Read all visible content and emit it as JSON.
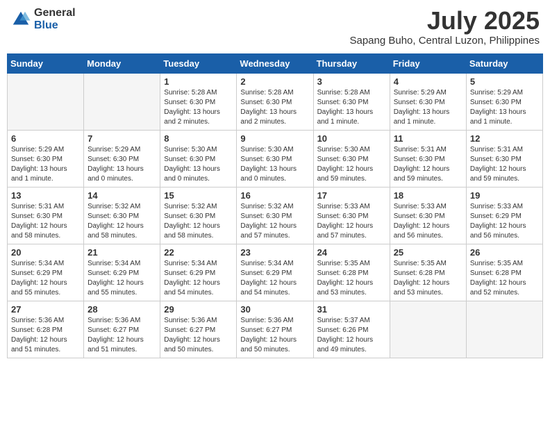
{
  "header": {
    "logo_general": "General",
    "logo_blue": "Blue",
    "month": "July 2025",
    "location": "Sapang Buho, Central Luzon, Philippines"
  },
  "weekdays": [
    "Sunday",
    "Monday",
    "Tuesday",
    "Wednesday",
    "Thursday",
    "Friday",
    "Saturday"
  ],
  "weeks": [
    [
      {
        "day": "",
        "empty": true
      },
      {
        "day": "",
        "empty": true
      },
      {
        "day": "1",
        "sunrise": "5:28 AM",
        "sunset": "6:30 PM",
        "daylight": "13 hours and 2 minutes."
      },
      {
        "day": "2",
        "sunrise": "5:28 AM",
        "sunset": "6:30 PM",
        "daylight": "13 hours and 2 minutes."
      },
      {
        "day": "3",
        "sunrise": "5:28 AM",
        "sunset": "6:30 PM",
        "daylight": "13 hours and 1 minute."
      },
      {
        "day": "4",
        "sunrise": "5:29 AM",
        "sunset": "6:30 PM",
        "daylight": "13 hours and 1 minute."
      },
      {
        "day": "5",
        "sunrise": "5:29 AM",
        "sunset": "6:30 PM",
        "daylight": "13 hours and 1 minute."
      }
    ],
    [
      {
        "day": "6",
        "sunrise": "5:29 AM",
        "sunset": "6:30 PM",
        "daylight": "13 hours and 1 minute."
      },
      {
        "day": "7",
        "sunrise": "5:29 AM",
        "sunset": "6:30 PM",
        "daylight": "13 hours and 0 minutes."
      },
      {
        "day": "8",
        "sunrise": "5:30 AM",
        "sunset": "6:30 PM",
        "daylight": "13 hours and 0 minutes."
      },
      {
        "day": "9",
        "sunrise": "5:30 AM",
        "sunset": "6:30 PM",
        "daylight": "13 hours and 0 minutes."
      },
      {
        "day": "10",
        "sunrise": "5:30 AM",
        "sunset": "6:30 PM",
        "daylight": "12 hours and 59 minutes."
      },
      {
        "day": "11",
        "sunrise": "5:31 AM",
        "sunset": "6:30 PM",
        "daylight": "12 hours and 59 minutes."
      },
      {
        "day": "12",
        "sunrise": "5:31 AM",
        "sunset": "6:30 PM",
        "daylight": "12 hours and 59 minutes."
      }
    ],
    [
      {
        "day": "13",
        "sunrise": "5:31 AM",
        "sunset": "6:30 PM",
        "daylight": "12 hours and 58 minutes."
      },
      {
        "day": "14",
        "sunrise": "5:32 AM",
        "sunset": "6:30 PM",
        "daylight": "12 hours and 58 minutes."
      },
      {
        "day": "15",
        "sunrise": "5:32 AM",
        "sunset": "6:30 PM",
        "daylight": "12 hours and 58 minutes."
      },
      {
        "day": "16",
        "sunrise": "5:32 AM",
        "sunset": "6:30 PM",
        "daylight": "12 hours and 57 minutes."
      },
      {
        "day": "17",
        "sunrise": "5:33 AM",
        "sunset": "6:30 PM",
        "daylight": "12 hours and 57 minutes."
      },
      {
        "day": "18",
        "sunrise": "5:33 AM",
        "sunset": "6:30 PM",
        "daylight": "12 hours and 56 minutes."
      },
      {
        "day": "19",
        "sunrise": "5:33 AM",
        "sunset": "6:29 PM",
        "daylight": "12 hours and 56 minutes."
      }
    ],
    [
      {
        "day": "20",
        "sunrise": "5:34 AM",
        "sunset": "6:29 PM",
        "daylight": "12 hours and 55 minutes."
      },
      {
        "day": "21",
        "sunrise": "5:34 AM",
        "sunset": "6:29 PM",
        "daylight": "12 hours and 55 minutes."
      },
      {
        "day": "22",
        "sunrise": "5:34 AM",
        "sunset": "6:29 PM",
        "daylight": "12 hours and 54 minutes."
      },
      {
        "day": "23",
        "sunrise": "5:34 AM",
        "sunset": "6:29 PM",
        "daylight": "12 hours and 54 minutes."
      },
      {
        "day": "24",
        "sunrise": "5:35 AM",
        "sunset": "6:28 PM",
        "daylight": "12 hours and 53 minutes."
      },
      {
        "day": "25",
        "sunrise": "5:35 AM",
        "sunset": "6:28 PM",
        "daylight": "12 hours and 53 minutes."
      },
      {
        "day": "26",
        "sunrise": "5:35 AM",
        "sunset": "6:28 PM",
        "daylight": "12 hours and 52 minutes."
      }
    ],
    [
      {
        "day": "27",
        "sunrise": "5:36 AM",
        "sunset": "6:28 PM",
        "daylight": "12 hours and 51 minutes."
      },
      {
        "day": "28",
        "sunrise": "5:36 AM",
        "sunset": "6:27 PM",
        "daylight": "12 hours and 51 minutes."
      },
      {
        "day": "29",
        "sunrise": "5:36 AM",
        "sunset": "6:27 PM",
        "daylight": "12 hours and 50 minutes."
      },
      {
        "day": "30",
        "sunrise": "5:36 AM",
        "sunset": "6:27 PM",
        "daylight": "12 hours and 50 minutes."
      },
      {
        "day": "31",
        "sunrise": "5:37 AM",
        "sunset": "6:26 PM",
        "daylight": "12 hours and 49 minutes."
      },
      {
        "day": "",
        "empty": true
      },
      {
        "day": "",
        "empty": true
      }
    ]
  ]
}
